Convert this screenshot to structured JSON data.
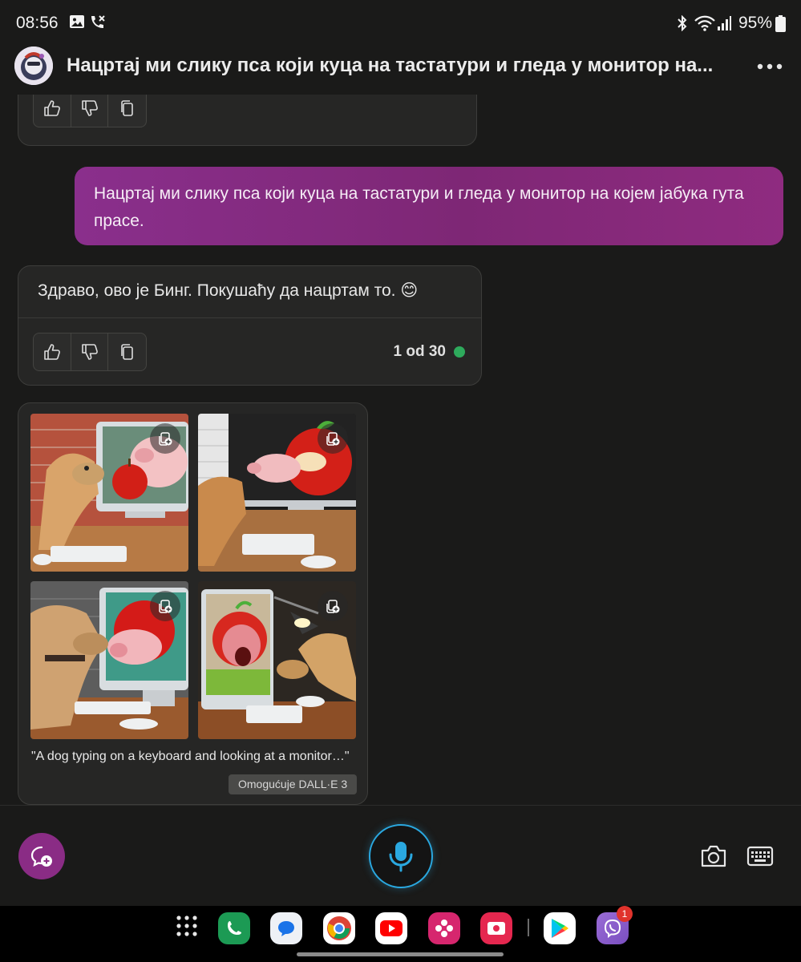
{
  "status_bar": {
    "time": "08:56",
    "battery": "95%",
    "icons": [
      "gallery-icon",
      "call-forwarding-icon",
      "bluetooth-icon",
      "wifi-icon",
      "signal-icon",
      "battery-icon"
    ]
  },
  "header": {
    "title": "Нацртај ми слику пса који куца на тастатури и гледа у монитор на...",
    "menu_icon": "more-options-icon"
  },
  "messages": {
    "user_prompt": "Нацртај ми слику пса који куца на тастатури и гледа у монитор на којем јабука гута прасе.",
    "bot_reply": "Здраво, ово је Бинг. Покушаћу да нацртам то. 😊",
    "counter": "1 od 30",
    "feedback_icons": [
      "thumbs-up-icon",
      "thumbs-down-icon",
      "copy-icon"
    ]
  },
  "image_card": {
    "caption": "\"A dog typing on a keyboard and looking at a monitor…\"",
    "badge": "Omogućuje DALL·E 3",
    "images": [
      "dog-monitor-pig-apple-image-1",
      "dog-monitor-pig-apple-image-2",
      "dog-monitor-pig-apple-image-3",
      "dog-monitor-pig-apple-image-4"
    ]
  },
  "input_bar": {
    "new_topic_icon": "new-topic-icon",
    "mic_icon": "microphone-icon",
    "camera_icon": "camera-icon",
    "keyboard_icon": "keyboard-icon"
  },
  "dock": {
    "apps": [
      "apps-grid",
      "phone",
      "messages",
      "chrome",
      "youtube",
      "gallery",
      "screen-recorder",
      "play-store",
      "viber"
    ],
    "viber_badge": "1"
  },
  "colors": {
    "background": "#1a1a19",
    "card": "#262625",
    "user_bubble": "#8a2f8c",
    "accent_mic": "#2aa8e0",
    "status_dot": "#2eaa5c"
  }
}
